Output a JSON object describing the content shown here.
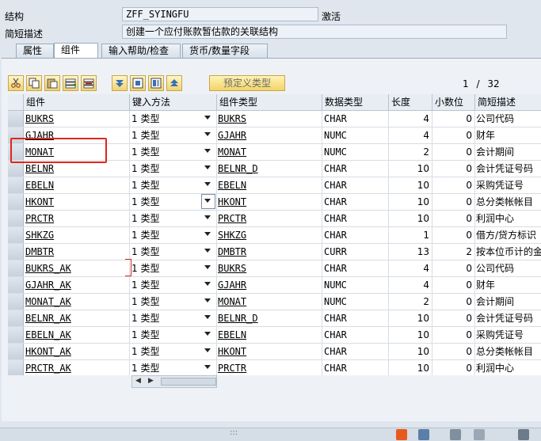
{
  "header": {
    "structure_label": "结构",
    "structure_value": "ZFF_SYINGFU",
    "status": "激活",
    "short_desc_label": "简短描述",
    "short_desc_value": "创建一个应付账款暂估款的关联结构"
  },
  "tabs": [
    {
      "label": "属性",
      "active": false
    },
    {
      "label": "组件",
      "active": true
    },
    {
      "label": "输入帮助/检查",
      "active": false
    },
    {
      "label": "货币/数量字段",
      "active": false
    }
  ],
  "toolbar": {
    "icons": [
      "cut-icon",
      "copy-icon",
      "paste-icon",
      "insert-row-icon",
      "delete-row-icon",
      "move-down-icon",
      "select-block-icon",
      "copy-block-icon",
      "move-up-icon"
    ],
    "predefined_type_label": "预定义类型"
  },
  "pager": {
    "current": "1",
    "separator": "/",
    "total": "32"
  },
  "table": {
    "columns": [
      "组件",
      "键入方法",
      "组件类型",
      "数据类型",
      "长度",
      "小数位",
      "简短描述"
    ],
    "rows": [
      {
        "component": "BUKRS",
        "entry": "1 类型",
        "ctype": "BUKRS",
        "dtype": "CHAR",
        "len": "4",
        "dec": "0",
        "desc": "公司代码"
      },
      {
        "component": "GJAHR",
        "entry": "1 类型",
        "ctype": "GJAHR",
        "dtype": "NUMC",
        "len": "4",
        "dec": "0",
        "desc": "财年"
      },
      {
        "component": "MONAT",
        "entry": "1 类型",
        "ctype": "MONAT",
        "dtype": "NUMC",
        "len": "2",
        "dec": "0",
        "desc": "会计期间"
      },
      {
        "component": "BELNR",
        "entry": "1 类型",
        "ctype": "BELNR_D",
        "dtype": "CHAR",
        "len": "10",
        "dec": "0",
        "desc": "会计凭证号码"
      },
      {
        "component": "EBELN",
        "entry": "1 类型",
        "ctype": "EBELN",
        "dtype": "CHAR",
        "len": "10",
        "dec": "0",
        "desc": "采购凭证号"
      },
      {
        "component": "HKONT",
        "entry": "1 类型",
        "ctype": "HKONT",
        "dtype": "CHAR",
        "len": "10",
        "dec": "0",
        "desc": "总分类帐帐目"
      },
      {
        "component": "PRCTR",
        "entry": "1 类型",
        "ctype": "PRCTR",
        "dtype": "CHAR",
        "len": "10",
        "dec": "0",
        "desc": "利润中心"
      },
      {
        "component": "SHKZG",
        "entry": "1 类型",
        "ctype": "SHKZG",
        "dtype": "CHAR",
        "len": "1",
        "dec": "0",
        "desc": "借方/贷方标识"
      },
      {
        "component": "DMBTR",
        "entry": "1 类型",
        "ctype": "DMBTR",
        "dtype": "CURR",
        "len": "13",
        "dec": "2",
        "desc": "按本位币计的金额"
      },
      {
        "component": "BUKRS_AK",
        "entry": "1 类型",
        "ctype": "BUKRS",
        "dtype": "CHAR",
        "len": "4",
        "dec": "0",
        "desc": "公司代码"
      },
      {
        "component": "GJAHR_AK",
        "entry": "1 类型",
        "ctype": "GJAHR",
        "dtype": "NUMC",
        "len": "4",
        "dec": "0",
        "desc": "财年"
      },
      {
        "component": "MONAT_AK",
        "entry": "1 类型",
        "ctype": "MONAT",
        "dtype": "NUMC",
        "len": "2",
        "dec": "0",
        "desc": "会计期间"
      },
      {
        "component": "BELNR_AK",
        "entry": "1 类型",
        "ctype": "BELNR_D",
        "dtype": "CHAR",
        "len": "10",
        "dec": "0",
        "desc": "会计凭证号码"
      },
      {
        "component": "EBELN_AK",
        "entry": "1 类型",
        "ctype": "EBELN",
        "dtype": "CHAR",
        "len": "10",
        "dec": "0",
        "desc": "采购凭证号"
      },
      {
        "component": "HKONT_AK",
        "entry": "1 类型",
        "ctype": "HKONT",
        "dtype": "CHAR",
        "len": "10",
        "dec": "0",
        "desc": "总分类帐帐目"
      },
      {
        "component": "PRCTR_AK",
        "entry": "1 类型",
        "ctype": "PRCTR",
        "dtype": "CHAR",
        "len": "10",
        "dec": "0",
        "desc": "利润中心"
      }
    ]
  },
  "colors": {
    "highlight": "#e0261c",
    "toolbar_button": "#f0d472"
  }
}
